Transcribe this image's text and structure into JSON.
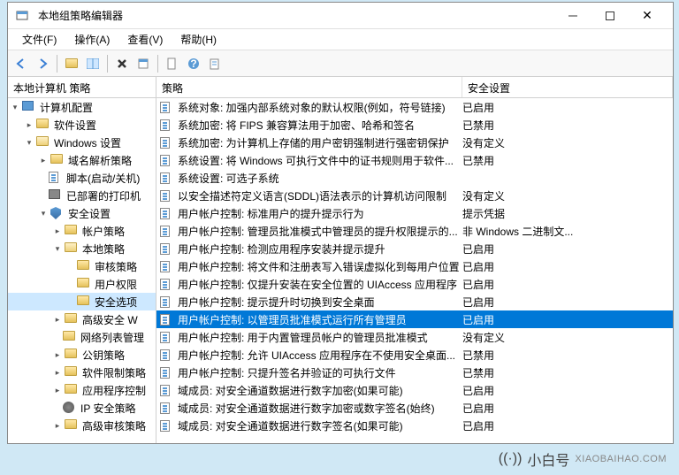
{
  "window": {
    "title": "本地组策略编辑器"
  },
  "menu": {
    "file": "文件(F)",
    "action": "操作(A)",
    "view": "查看(V)",
    "help": "帮助(H)"
  },
  "tree": {
    "header": "本地计算机 策略",
    "root1": "计算机配置",
    "soft": "软件设置",
    "win": "Windows 设置",
    "dns": "域名解析策略",
    "script": "脚本(启动/关机)",
    "printer": "已部署的打印机",
    "sec": "安全设置",
    "acct": "帐户策略",
    "local": "本地策略",
    "audit": "审核策略",
    "rights": "用户权限",
    "secopt": "安全选项",
    "advW": "高级安全 W",
    "netlist": "网络列表管理",
    "pubkey": "公钥策略",
    "softrest": "软件限制策略",
    "appctrl": "应用程序控制",
    "ipsec": "IP 安全策略",
    "advaudit": "高级审核策略"
  },
  "columns": {
    "policy": "策略",
    "setting": "安全设置"
  },
  "rows": [
    {
      "p": "系统对象: 加强内部系统对象的默认权限(例如，符号链接)",
      "s": "已启用"
    },
    {
      "p": "系统加密: 将 FIPS 兼容算法用于加密、哈希和签名",
      "s": "已禁用"
    },
    {
      "p": "系统加密: 为计算机上存储的用户密钥强制进行强密钥保护",
      "s": "没有定义"
    },
    {
      "p": "系统设置: 将 Windows 可执行文件中的证书规则用于软件...",
      "s": "已禁用"
    },
    {
      "p": "系统设置: 可选子系统",
      "s": ""
    },
    {
      "p": "以安全描述符定义语言(SDDL)语法表示的计算机访问限制",
      "s": "没有定义"
    },
    {
      "p": "用户帐户控制: 标准用户的提升提示行为",
      "s": "提示凭据"
    },
    {
      "p": "用户帐户控制: 管理员批准模式中管理员的提升权限提示的...",
      "s": "非 Windows 二进制文..."
    },
    {
      "p": "用户帐户控制: 检测应用程序安装并提示提升",
      "s": "已启用"
    },
    {
      "p": "用户帐户控制: 将文件和注册表写入错误虚拟化到每用户位置",
      "s": "已启用"
    },
    {
      "p": "用户帐户控制: 仅提升安装在安全位置的 UIAccess 应用程序",
      "s": "已启用"
    },
    {
      "p": "用户帐户控制: 提示提升时切换到安全桌面",
      "s": "已启用"
    },
    {
      "p": "用户帐户控制: 以管理员批准模式运行所有管理员",
      "s": "已启用",
      "sel": true
    },
    {
      "p": "用户帐户控制: 用于内置管理员帐户的管理员批准模式",
      "s": "没有定义"
    },
    {
      "p": "用户帐户控制: 允许 UIAccess 应用程序在不使用安全桌面...",
      "s": "已禁用"
    },
    {
      "p": "用户帐户控制: 只提升签名并验证的可执行文件",
      "s": "已禁用"
    },
    {
      "p": "域成员: 对安全通道数据进行数字加密(如果可能)",
      "s": "已启用"
    },
    {
      "p": "域成员: 对安全通道数据进行数字加密或数字签名(始终)",
      "s": "已启用"
    },
    {
      "p": "域成员: 对安全通道数据进行数字签名(如果可能)",
      "s": "已启用"
    }
  ],
  "watermark": {
    "brand": "小白号",
    "url": "XIAOBAIHAO.COM"
  }
}
